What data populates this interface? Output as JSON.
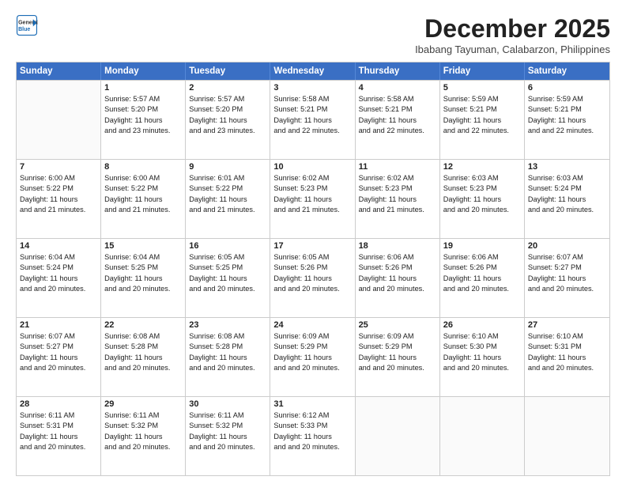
{
  "header": {
    "logo_line1": "General",
    "logo_line2": "Blue",
    "month": "December 2025",
    "location": "Ibabang Tayuman, Calabarzon, Philippines"
  },
  "weekdays": [
    "Sunday",
    "Monday",
    "Tuesday",
    "Wednesday",
    "Thursday",
    "Friday",
    "Saturday"
  ],
  "weeks": [
    [
      {
        "day": "",
        "sunrise": "",
        "sunset": "",
        "daylight": ""
      },
      {
        "day": "1",
        "sunrise": "Sunrise: 5:57 AM",
        "sunset": "Sunset: 5:20 PM",
        "daylight": "Daylight: 11 hours and 23 minutes."
      },
      {
        "day": "2",
        "sunrise": "Sunrise: 5:57 AM",
        "sunset": "Sunset: 5:20 PM",
        "daylight": "Daylight: 11 hours and 23 minutes."
      },
      {
        "day": "3",
        "sunrise": "Sunrise: 5:58 AM",
        "sunset": "Sunset: 5:21 PM",
        "daylight": "Daylight: 11 hours and 22 minutes."
      },
      {
        "day": "4",
        "sunrise": "Sunrise: 5:58 AM",
        "sunset": "Sunset: 5:21 PM",
        "daylight": "Daylight: 11 hours and 22 minutes."
      },
      {
        "day": "5",
        "sunrise": "Sunrise: 5:59 AM",
        "sunset": "Sunset: 5:21 PM",
        "daylight": "Daylight: 11 hours and 22 minutes."
      },
      {
        "day": "6",
        "sunrise": "Sunrise: 5:59 AM",
        "sunset": "Sunset: 5:21 PM",
        "daylight": "Daylight: 11 hours and 22 minutes."
      }
    ],
    [
      {
        "day": "7",
        "sunrise": "Sunrise: 6:00 AM",
        "sunset": "Sunset: 5:22 PM",
        "daylight": "Daylight: 11 hours and 21 minutes."
      },
      {
        "day": "8",
        "sunrise": "Sunrise: 6:00 AM",
        "sunset": "Sunset: 5:22 PM",
        "daylight": "Daylight: 11 hours and 21 minutes."
      },
      {
        "day": "9",
        "sunrise": "Sunrise: 6:01 AM",
        "sunset": "Sunset: 5:22 PM",
        "daylight": "Daylight: 11 hours and 21 minutes."
      },
      {
        "day": "10",
        "sunrise": "Sunrise: 6:02 AM",
        "sunset": "Sunset: 5:23 PM",
        "daylight": "Daylight: 11 hours and 21 minutes."
      },
      {
        "day": "11",
        "sunrise": "Sunrise: 6:02 AM",
        "sunset": "Sunset: 5:23 PM",
        "daylight": "Daylight: 11 hours and 21 minutes."
      },
      {
        "day": "12",
        "sunrise": "Sunrise: 6:03 AM",
        "sunset": "Sunset: 5:23 PM",
        "daylight": "Daylight: 11 hours and 20 minutes."
      },
      {
        "day": "13",
        "sunrise": "Sunrise: 6:03 AM",
        "sunset": "Sunset: 5:24 PM",
        "daylight": "Daylight: 11 hours and 20 minutes."
      }
    ],
    [
      {
        "day": "14",
        "sunrise": "Sunrise: 6:04 AM",
        "sunset": "Sunset: 5:24 PM",
        "daylight": "Daylight: 11 hours and 20 minutes."
      },
      {
        "day": "15",
        "sunrise": "Sunrise: 6:04 AM",
        "sunset": "Sunset: 5:25 PM",
        "daylight": "Daylight: 11 hours and 20 minutes."
      },
      {
        "day": "16",
        "sunrise": "Sunrise: 6:05 AM",
        "sunset": "Sunset: 5:25 PM",
        "daylight": "Daylight: 11 hours and 20 minutes."
      },
      {
        "day": "17",
        "sunrise": "Sunrise: 6:05 AM",
        "sunset": "Sunset: 5:26 PM",
        "daylight": "Daylight: 11 hours and 20 minutes."
      },
      {
        "day": "18",
        "sunrise": "Sunrise: 6:06 AM",
        "sunset": "Sunset: 5:26 PM",
        "daylight": "Daylight: 11 hours and 20 minutes."
      },
      {
        "day": "19",
        "sunrise": "Sunrise: 6:06 AM",
        "sunset": "Sunset: 5:26 PM",
        "daylight": "Daylight: 11 hours and 20 minutes."
      },
      {
        "day": "20",
        "sunrise": "Sunrise: 6:07 AM",
        "sunset": "Sunset: 5:27 PM",
        "daylight": "Daylight: 11 hours and 20 minutes."
      }
    ],
    [
      {
        "day": "21",
        "sunrise": "Sunrise: 6:07 AM",
        "sunset": "Sunset: 5:27 PM",
        "daylight": "Daylight: 11 hours and 20 minutes."
      },
      {
        "day": "22",
        "sunrise": "Sunrise: 6:08 AM",
        "sunset": "Sunset: 5:28 PM",
        "daylight": "Daylight: 11 hours and 20 minutes."
      },
      {
        "day": "23",
        "sunrise": "Sunrise: 6:08 AM",
        "sunset": "Sunset: 5:28 PM",
        "daylight": "Daylight: 11 hours and 20 minutes."
      },
      {
        "day": "24",
        "sunrise": "Sunrise: 6:09 AM",
        "sunset": "Sunset: 5:29 PM",
        "daylight": "Daylight: 11 hours and 20 minutes."
      },
      {
        "day": "25",
        "sunrise": "Sunrise: 6:09 AM",
        "sunset": "Sunset: 5:29 PM",
        "daylight": "Daylight: 11 hours and 20 minutes."
      },
      {
        "day": "26",
        "sunrise": "Sunrise: 6:10 AM",
        "sunset": "Sunset: 5:30 PM",
        "daylight": "Daylight: 11 hours and 20 minutes."
      },
      {
        "day": "27",
        "sunrise": "Sunrise: 6:10 AM",
        "sunset": "Sunset: 5:31 PM",
        "daylight": "Daylight: 11 hours and 20 minutes."
      }
    ],
    [
      {
        "day": "28",
        "sunrise": "Sunrise: 6:11 AM",
        "sunset": "Sunset: 5:31 PM",
        "daylight": "Daylight: 11 hours and 20 minutes."
      },
      {
        "day": "29",
        "sunrise": "Sunrise: 6:11 AM",
        "sunset": "Sunset: 5:32 PM",
        "daylight": "Daylight: 11 hours and 20 minutes."
      },
      {
        "day": "30",
        "sunrise": "Sunrise: 6:11 AM",
        "sunset": "Sunset: 5:32 PM",
        "daylight": "Daylight: 11 hours and 20 minutes."
      },
      {
        "day": "31",
        "sunrise": "Sunrise: 6:12 AM",
        "sunset": "Sunset: 5:33 PM",
        "daylight": "Daylight: 11 hours and 20 minutes."
      },
      {
        "day": "",
        "sunrise": "",
        "sunset": "",
        "daylight": ""
      },
      {
        "day": "",
        "sunrise": "",
        "sunset": "",
        "daylight": ""
      },
      {
        "day": "",
        "sunrise": "",
        "sunset": "",
        "daylight": ""
      }
    ]
  ]
}
